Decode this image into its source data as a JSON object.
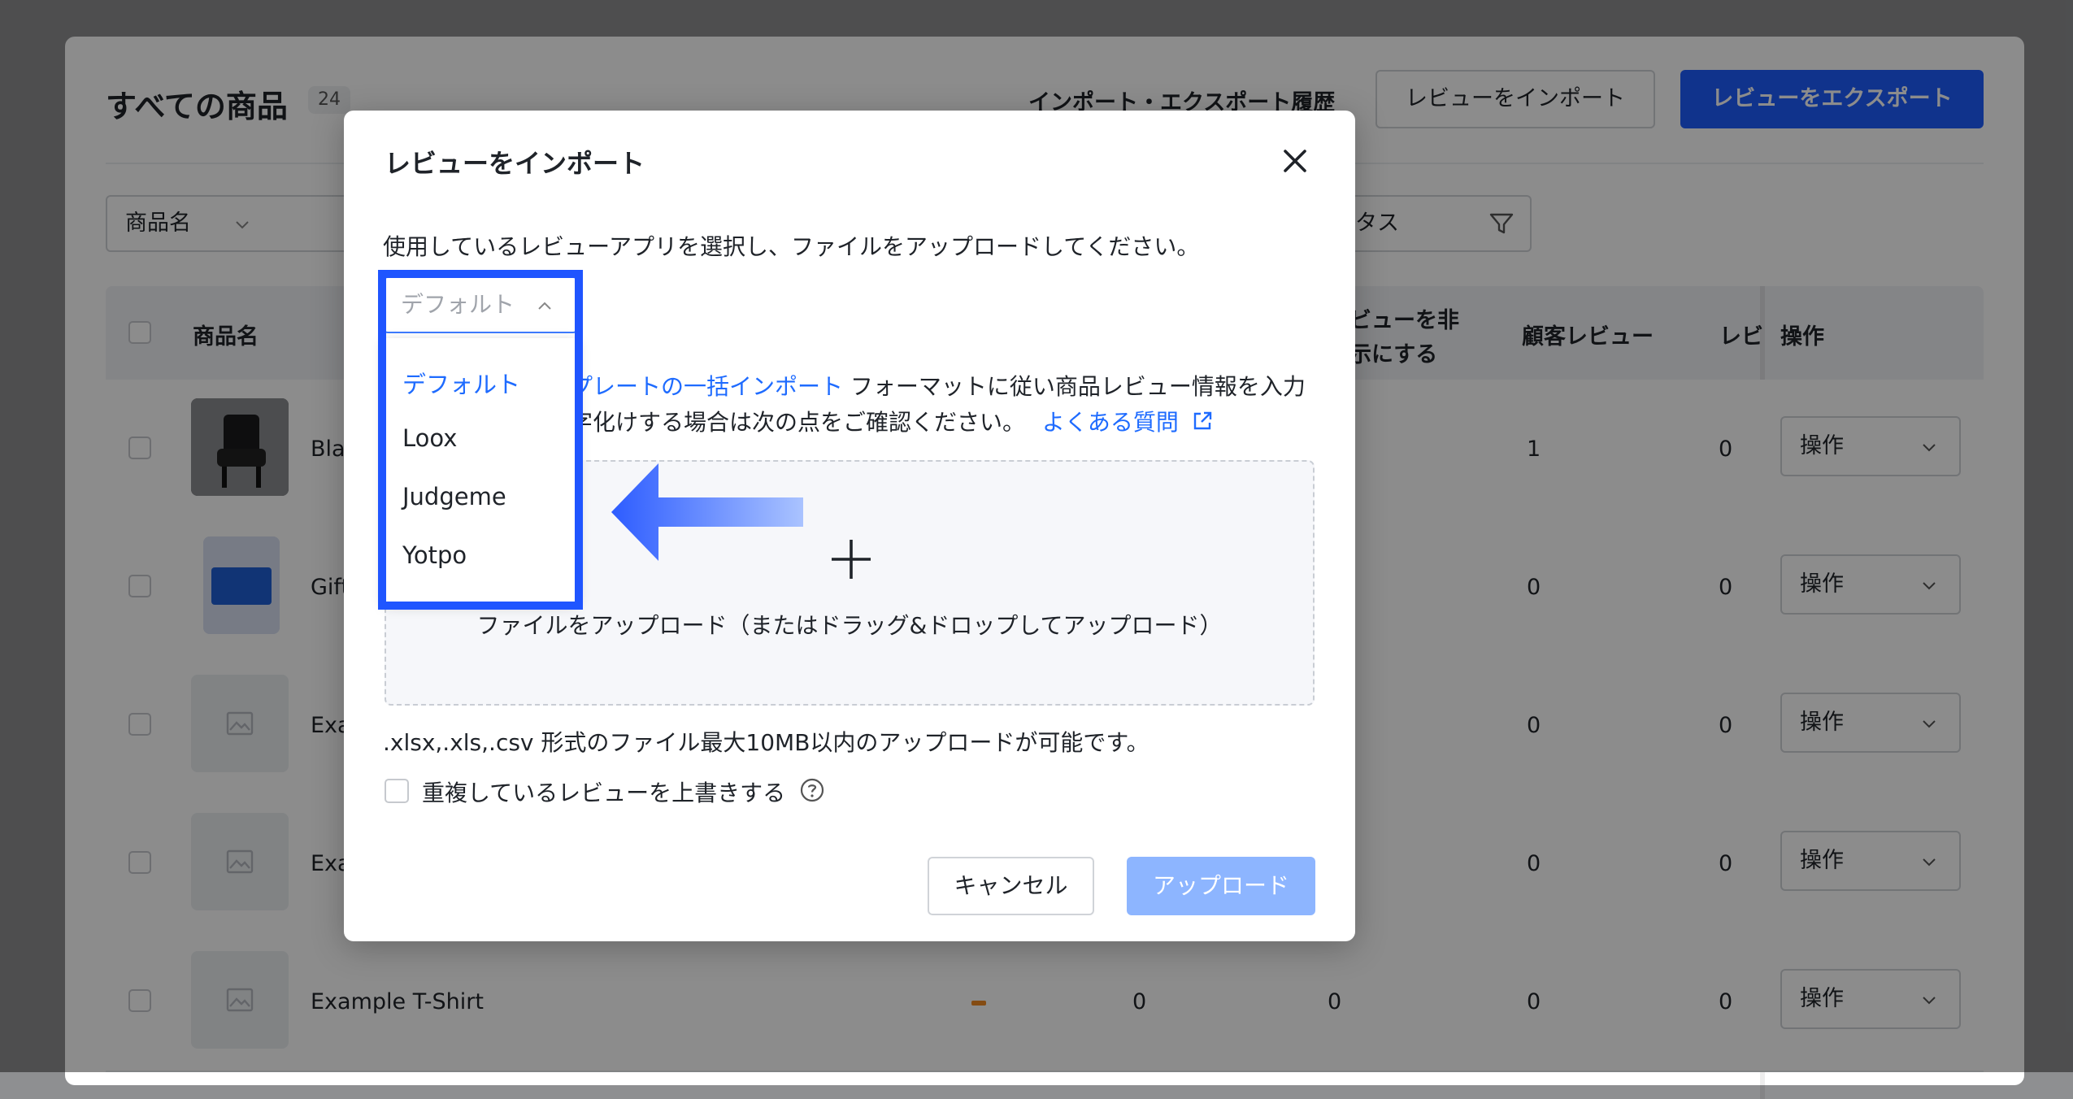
{
  "page": {
    "title": "すべての商品",
    "count": "24",
    "history_link": "インポート・エクスポート履歴",
    "import_button": "レビューをインポート",
    "export_button": "レビューをエクスポート",
    "filter_select": "商品名",
    "status_filter": "ータス"
  },
  "table": {
    "headers": {
      "product": "商品名",
      "hide_line1": "ビューを非",
      "hide_line2": "示にする",
      "customer_reviews": "顧客レビュー",
      "reviews_cut": "レビ",
      "actions": "操作"
    },
    "rows": [
      {
        "name": "Bla",
        "customer_reviews": "1",
        "last": "0",
        "action": "操作"
      },
      {
        "name": "Gift",
        "customer_reviews": "0",
        "last": "0",
        "action": "操作"
      },
      {
        "name": "Exa",
        "customer_reviews": "0",
        "last": "0",
        "action": "操作"
      },
      {
        "name": "Exa",
        "customer_reviews": "0",
        "last": "0",
        "action": "操作"
      },
      {
        "name": "Example T-Shirt",
        "col_a": "0",
        "col_b": "0",
        "customer_reviews": "0",
        "last": "0",
        "action": "操作"
      }
    ]
  },
  "modal": {
    "title": "レビューをインポート",
    "description": "使用しているレビューアプリを選択し、ファイルをアップロードしてください。",
    "select_value": "デフォルト",
    "info_link1": "プレートの一括インポート",
    "info_text1": " フォーマットに従い商品レビュー情報を入力",
    "info_text2": "字化けする場合は次の点をご確認ください。",
    "faq_link": "よくある質問",
    "upload_text": "ファイルをアップロード（またはドラッグ&ドロップしてアップロード）",
    "format_note": ".xlsx,.xls,.csv 形式のファイル最大10MB以内のアップロードが可能です。",
    "overwrite_label": "重複しているレビューを上書きする",
    "cancel_button": "キャンセル",
    "upload_button": "アップロード"
  },
  "dropdown": {
    "options": [
      "デフォルト",
      "Loox",
      "Judgeme",
      "Yotpo"
    ],
    "selected": "デフォルト"
  },
  "colors": {
    "primary": "#1e5eff",
    "link": "#1e6bff",
    "highlight": "#1f55ff",
    "upload_disabled": "#8db5ff"
  }
}
